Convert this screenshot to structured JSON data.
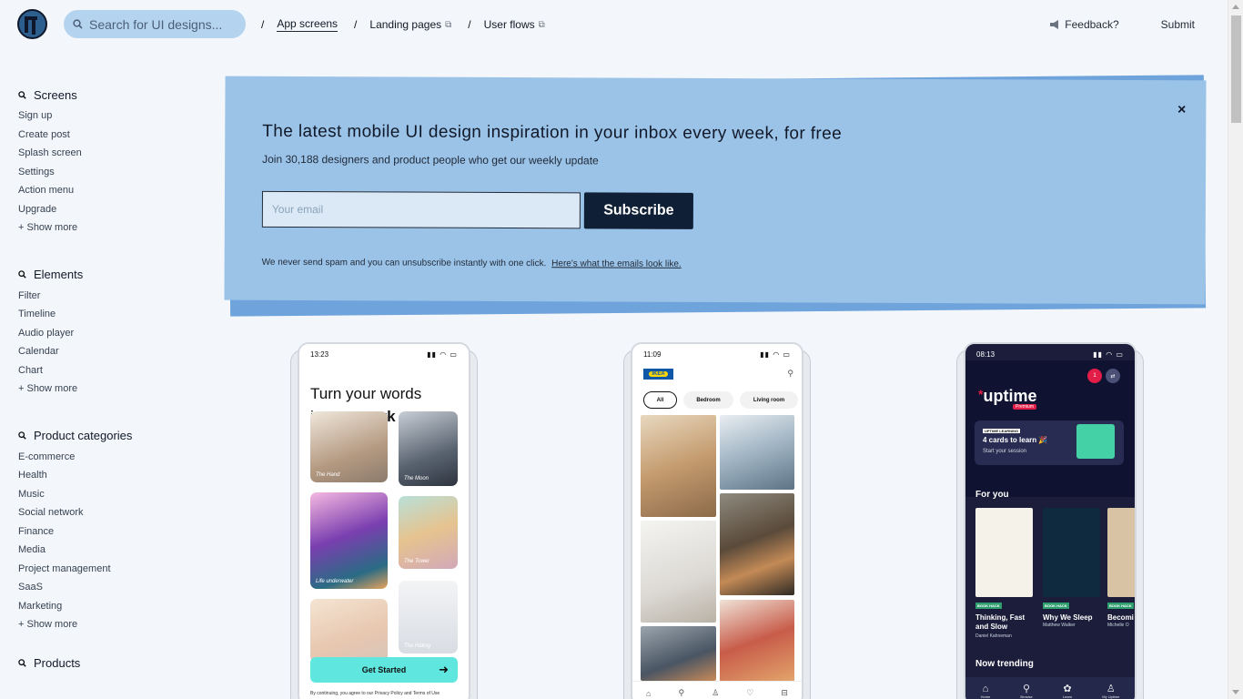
{
  "header": {
    "search_placeholder": "Search for UI designs...",
    "breadcrumbs": [
      {
        "label": "App screens",
        "active": true,
        "external": false
      },
      {
        "label": "Landing pages",
        "active": false,
        "external": true
      },
      {
        "label": "User flows",
        "active": false,
        "external": true
      }
    ],
    "feedback_label": "Feedback?",
    "submit_label": "Submit"
  },
  "sidebar": {
    "sections": [
      {
        "title": "Screens",
        "items": [
          "Sign up",
          "Create post",
          "Splash screen",
          "Settings",
          "Action menu",
          "Upgrade",
          "+ Show more"
        ]
      },
      {
        "title": "Elements",
        "items": [
          "Filter",
          "Timeline",
          "Audio player",
          "Calendar",
          "Chart",
          "+ Show more"
        ]
      },
      {
        "title": "Product categories",
        "items": [
          "E-commerce",
          "Health",
          "Music",
          "Social network",
          "Finance",
          "Media",
          "Project management",
          "SaaS",
          "Marketing",
          "+ Show more"
        ]
      },
      {
        "title": "Products",
        "items": []
      }
    ]
  },
  "banner": {
    "title": "The latest mobile UI design inspiration in your inbox every week, for free",
    "subtitle": "Join 30,188 designers and product people who get our weekly update",
    "email_placeholder": "Your email",
    "subscribe_label": "Subscribe",
    "note": "We never send spam and you can unsubscribe instantly with one click.",
    "note_link": "Here's what the emails look like.",
    "close_symbol": "×"
  },
  "phones": {
    "p1": {
      "time": "13:23",
      "title_line1": "Turn your words",
      "title_line2_plain": "into ",
      "title_line2_bold": "artwork",
      "tiles": [
        "The Hand",
        "The Moon",
        "Life underwater",
        "The Tower",
        "",
        "The Hiding"
      ],
      "cta": "Get Started",
      "terms": "By continuing, you agree to our Privacy Policy and Terms of Use"
    },
    "p2": {
      "time": "11:09",
      "brand": "IKEA",
      "chips": [
        "All",
        "Bedroom",
        "Living room"
      ]
    },
    "p3": {
      "time": "08:13",
      "brand": "uptime",
      "premium": "Premium",
      "notif_count": "1",
      "learn_tag": "UPTIME LEARNING",
      "learn_title": "4 cards to learn 🎉",
      "learn_sub": "Start your session",
      "for_you": "For you",
      "books": [
        {
          "tag": "BOOK HACK",
          "title": "Thinking, Fast and Slow",
          "author": "Daniel Kahneman"
        },
        {
          "tag": "BOOK HACK",
          "title": "Why We Sleep",
          "author": "Matthew Walker"
        },
        {
          "tag": "BOOK HACK",
          "title": "Becomi",
          "author": "Michelle O"
        }
      ],
      "now_trending": "Now trending",
      "nav": [
        "Home",
        "Browse",
        "Learn",
        "My Uptime"
      ]
    }
  }
}
